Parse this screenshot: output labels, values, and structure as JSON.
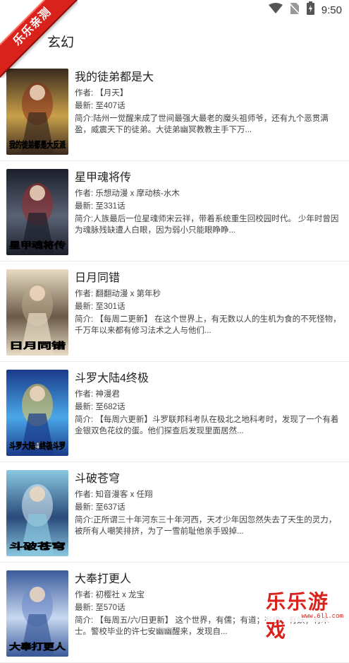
{
  "status": {
    "time": "9:50",
    "icons": [
      "wifi-icon",
      "no-sim-icon",
      "battery-charging-icon"
    ]
  },
  "ribbon": {
    "text": "乐乐亲测"
  },
  "header": {
    "title": "玄幻"
  },
  "comics": [
    {
      "title": "我的徒弟都是大",
      "author": "作者: 【月天】",
      "latest": "最新: 至407话",
      "desc": "简介:陆州一觉醒来成了世间最强大最老的魔头祖师爷，还有九个恶贯满盈，威震天下的徒弟。大徒弟幽冥教教主手下万...",
      "cover_text": "我的徒弟都是大反派",
      "cover_colors": [
        "#3a2a1e",
        "#c9a04a",
        "#8a2e1c"
      ]
    },
    {
      "title": "星甲魂将传",
      "author": "作者: 乐想动漫 x 摩动核-水木",
      "latest": "最新: 至331话",
      "desc": "简介:人族最后一位星魂师宋云祥，带着系统重生回校园时代。 少年时曾因为魂脉残缺遭人白眼，因为弱小只能眼睁睁...",
      "cover_text": "星甲魂将传",
      "cover_colors": [
        "#1c1f2b",
        "#5a6274",
        "#9b2a2a"
      ]
    },
    {
      "title": "日月同错",
      "author": "作者: 翻翻动漫 x 第年秒",
      "latest": "最新: 至301话",
      "desc": "简介: 【每周二更新】 在这个世界上，有无数以人的生机为食的不死怪物，千万年以来都有修习法术之人与他们...",
      "cover_text": "日月同错",
      "cover_colors": [
        "#e8dcc4",
        "#6a5a48",
        "#b8a88a"
      ]
    },
    {
      "title": "斗罗大陆4终极",
      "author": "作者: 神漫君",
      "latest": "最新: 至682话",
      "desc": "简介: 【每周六更新】斗罗联邦科考队在极北之地科考时，发现了一个有着金银双色花纹的蛋。他们探查后发现里面居然...",
      "cover_text": "斗罗大陆4终极斗罗",
      "cover_colors": [
        "#1a3a8a",
        "#4aa8e8",
        "#f0c84a"
      ]
    },
    {
      "title": "斗破苍穹",
      "author": "作者: 知音漫客 x 任翔",
      "latest": "最新: 至637话",
      "desc": "简介:正所谓三十年河东三十年河西，天才少年因忽然失去了天生的灵力，被所有人嘲笑排挤，为了一雪前耻他亲手毁掉...",
      "cover_text": "斗破苍穹",
      "cover_colors": [
        "#8ac8e0",
        "#2a4a7a",
        "#e0f0f8"
      ]
    },
    {
      "title": "大奉打更人",
      "author": "作者: 初樱社 x 龙宝",
      "latest": "最新: 至570话",
      "desc": "简介: 【每周五/六/日更新】 这个世界，有儒；有道；有佛；有妖；有术士。警校毕业的许七安幽幽醒来，发现自...",
      "cover_text": "大奉打更人",
      "cover_colors": [
        "#3a5a9a",
        "#c8d8f0",
        "#6a88c8"
      ]
    }
  ],
  "watermark": {
    "main": "乐乐游戏",
    "sub": "www.6ll.com"
  }
}
